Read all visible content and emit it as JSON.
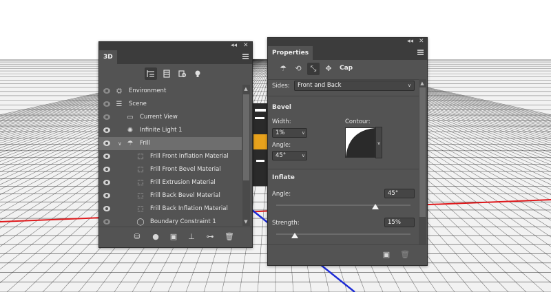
{
  "panel_3d": {
    "title": "3D",
    "collapse_glyph": "◂◂",
    "close_glyph": "✕",
    "filter_icons": [
      "scene-icon",
      "mesh-icon",
      "material-icon",
      "light-icon"
    ],
    "layers": [
      {
        "label": "Environment",
        "icon": "environment-icon",
        "visible": false,
        "depth": 0,
        "selected": false
      },
      {
        "label": "Scene",
        "icon": "scene-icon",
        "visible": false,
        "depth": 0,
        "selected": false
      },
      {
        "label": "Current View",
        "icon": "camera-icon",
        "visible": false,
        "depth": 1,
        "selected": false
      },
      {
        "label": "Infinite Light 1",
        "icon": "infinite-light-icon",
        "visible": true,
        "depth": 1,
        "selected": false
      },
      {
        "label": "Frill",
        "icon": "mesh-icon",
        "visible": true,
        "depth": 1,
        "selected": true,
        "expanded": true
      },
      {
        "label": "Frill Front Inflation Material",
        "icon": "material-icon",
        "visible": true,
        "depth": 2,
        "selected": false
      },
      {
        "label": "Frill Front Bevel Material",
        "icon": "material-icon",
        "visible": true,
        "depth": 2,
        "selected": false
      },
      {
        "label": "Frill Extrusion Material",
        "icon": "material-icon",
        "visible": true,
        "depth": 2,
        "selected": false
      },
      {
        "label": "Frill Back Bevel Material",
        "icon": "material-icon",
        "visible": true,
        "depth": 2,
        "selected": false
      },
      {
        "label": "Frill Back Inflation Material",
        "icon": "material-icon",
        "visible": true,
        "depth": 2,
        "selected": false
      },
      {
        "label": "Boundary Constraint 1",
        "icon": "constraint-icon",
        "visible": false,
        "depth": 2,
        "selected": false
      }
    ],
    "bottom_icons": [
      "add-mesh-icon",
      "add-light-icon",
      "render-icon",
      "ground-icon",
      "split-icon",
      "trash-icon"
    ]
  },
  "panel_properties": {
    "title": "Properties",
    "collapse_glyph": "◂◂",
    "close_glyph": "✕",
    "mode_icons": [
      "mesh-icon",
      "deform-icon",
      "cap-icon",
      "coordinates-icon"
    ],
    "active_mode_label": "Cap",
    "sides_label": "Sides:",
    "sides_value": "Front and Back",
    "bevel": {
      "title": "Bevel",
      "width_label": "Width:",
      "width_value": "1%",
      "angle_label": "Angle:",
      "angle_value": "45°",
      "contour_label": "Contour:"
    },
    "inflate": {
      "title": "Inflate",
      "angle_label": "Angle:",
      "angle_value": "45°",
      "angle_fraction": 0.74,
      "strength_label": "Strength:",
      "strength_value": "15%",
      "strength_fraction": 0.14
    },
    "bottom_icons": [
      "render-icon",
      "trash-icon"
    ]
  },
  "colors": {
    "panel_bg": "#535353",
    "panel_dark": "#3c3c3c",
    "grid_line": "#1a1a1a",
    "x_axis": "#e0191c",
    "z_axis": "#1c2bd6"
  }
}
